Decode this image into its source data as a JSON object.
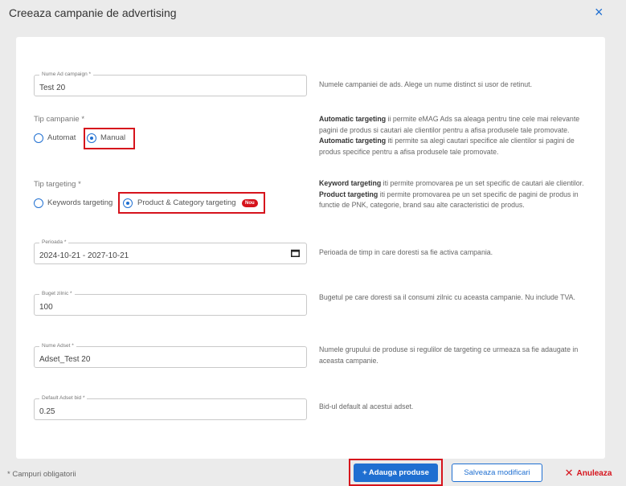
{
  "modal": {
    "title": "Creeaza campanie de advertising",
    "close_symbol": "×"
  },
  "fields": {
    "ad_campaign_name": {
      "label": "Nume Ad campaign *",
      "value": "Test 20",
      "help": "Numele campaniei de ads. Alege un nume distinct si usor de retinut."
    },
    "period": {
      "label": "Perioada *",
      "value": "2024-10-21 - 2027-10-21",
      "help": "Perioada de timp in care doresti sa fie activa campania."
    },
    "daily_budget": {
      "label": "Buget zilnic *",
      "value": "100",
      "help": "Bugetul pe care doresti sa il consumi zilnic cu aceasta campanie. Nu include TVA."
    },
    "adset_name": {
      "label": "Nume Adset *",
      "value": "Adset_Test 20",
      "help": "Numele grupului de produse si regulilor de targeting ce urmeaza sa fie adaugate in aceasta campanie."
    },
    "default_adset_bid": {
      "label": "Default Adset bid *",
      "value": "0.25",
      "help": "Bid-ul default al acestui adset."
    }
  },
  "campaign_type": {
    "label": "Tip campanie *",
    "options": [
      "Automat",
      "Manual"
    ],
    "selected": "Manual",
    "help": {
      "p1_bold": "Automatic targeting",
      "p1_text": " ii permite eMAG Ads sa aleaga pentru tine cele mai relevante pagini de produs si cautari ale clientilor pentru a afisa produsele tale promovate.",
      "p2_bold": "Automatic targeting",
      "p2_text": " iti permite sa alegi cautari specifice ale clientilor si pagini de produs specifice pentru a afisa produsele tale promovate."
    }
  },
  "targeting_type": {
    "label": "Tip targeting *",
    "options": [
      "Keywords targeting",
      "Product & Category targeting"
    ],
    "selected": "Product & Category targeting",
    "new_badge": "Nou",
    "help": {
      "p1_bold": "Keyword targeting",
      "p1_text": " iti permite promovarea pe un set specific de cautari ale clientilor.",
      "p2_bold": "Product targeting",
      "p2_text": " iti permite promovarea pe un set specific de pagini de produs in functie de PNK, categorie, brand sau alte caracteristici de produs."
    }
  },
  "footer": {
    "required_note": "* Campuri obligatorii",
    "add_products": "+ Adauga produse",
    "save": "Salveaza modificari",
    "cancel": "Anuleaza",
    "cancel_symbol": "✕"
  },
  "colors": {
    "accent": "#1f6fd1",
    "highlight": "#d6131c",
    "background": "#ebebeb"
  }
}
